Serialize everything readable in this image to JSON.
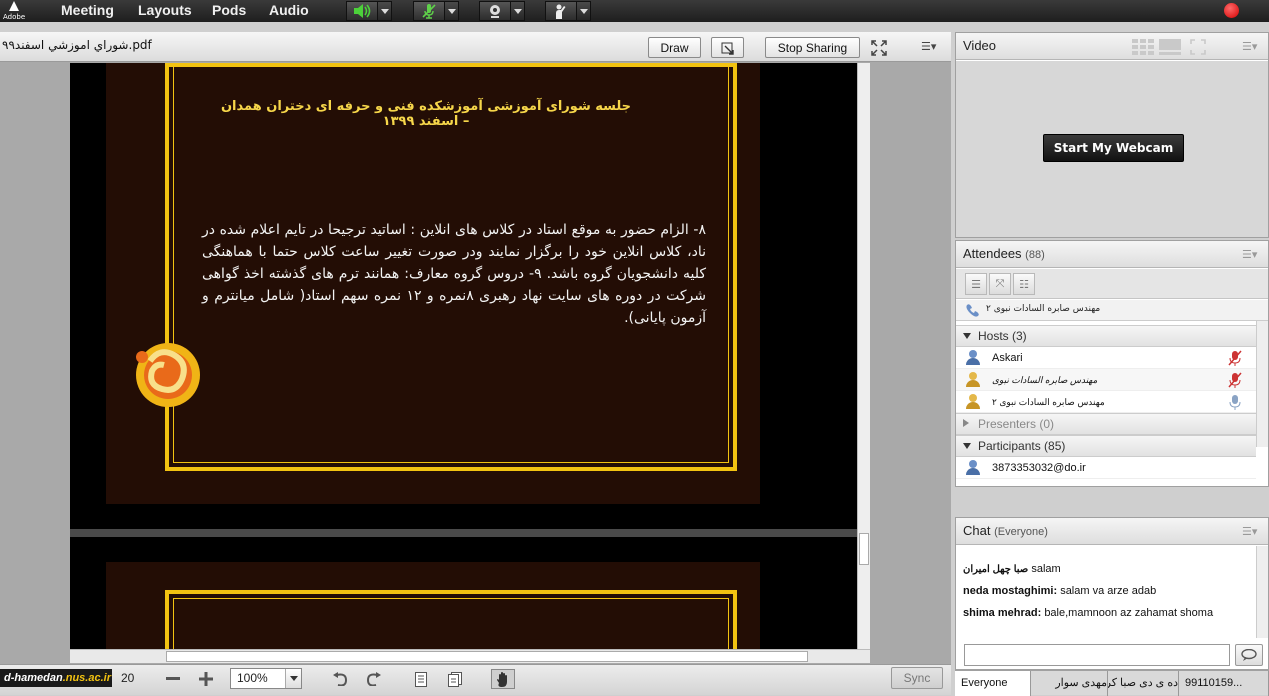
{
  "app": {
    "brand": "Adobe"
  },
  "menu": [
    "Meeting",
    "Layouts",
    "Pods",
    "Audio"
  ],
  "share": {
    "document_name": "شوراي اموزشي اسفند۹۹.pdf",
    "draw_label": "Draw",
    "stop_sharing_label": "Stop Sharing",
    "slide_title": "جلسه شورای آموزشی آموزشکده فنی و حرفه ای دختران همدان – اسفند ۱۳۹۹",
    "slide_body": "۸- الزام حضور به موقع استاد در کلاس های انلاین : اساتید ترجیحا در تایم اعلام شده در ناد، کلاس انلاین خود را برگزار نمایند ودر صورت تغییر ساعت کلاس حتما با هماهنگی کلیه دانشجویان گروه باشد. ۹- دروس گروه معارف: همانند ترم های گذشته اخذ گواهی شرکت در دوره های سایت نهاد رهبری ۸نمره و ۱۲ نمره سهم استاد( شامل میانترم و آزمون پایانی)."
  },
  "bottombar": {
    "watermark": "d-hamedan",
    "watermark_domain": ".nus.ac.ir",
    "page_total": "20",
    "zoom": "100%",
    "sync_label": "Sync"
  },
  "video": {
    "title": "Video",
    "webcam_label": "Start My Webcam"
  },
  "attendees": {
    "title": "Attendees",
    "count": "(88)",
    "speaking": "مهندس صابره السادات نبوی ۲",
    "hosts_label": "Hosts (3)",
    "hosts": [
      "Askari",
      "مهندس صابره السادات نبوی",
      "مهندس صابره السادات نبوی ۲"
    ],
    "presenters_label": "Presenters (0)",
    "participants_label": "Participants (85)",
    "participants": [
      "3873353032@do.ir"
    ]
  },
  "chat": {
    "title": "Chat",
    "scope": "(Everyone)",
    "messages": [
      {
        "sender": "صبا  چهل امیران",
        "text": "salam"
      },
      {
        "sender": "neda mostaghimi:",
        "text": "salam va arze adab"
      },
      {
        "sender": "shima mehrad:",
        "text": "bale,mamnoon az zahamat shoma"
      }
    ],
    "tabs": [
      "Everyone",
      "مهدی سوار",
      "ده ی دی صبا کر",
      "99110159..."
    ]
  },
  "colors": {
    "accent_gold": "#f2c211",
    "slide_bg": "#230d05",
    "record": "#d40000"
  }
}
